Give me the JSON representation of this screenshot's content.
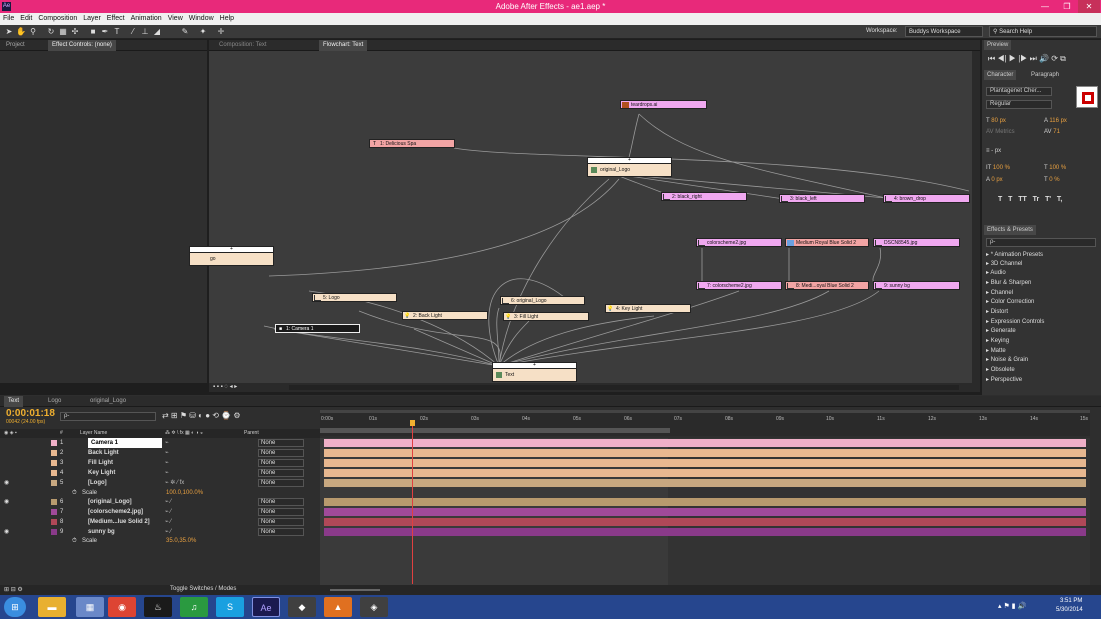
{
  "window": {
    "title": "Adobe After Effects - ae1.aep *",
    "app_icon": "Ae"
  },
  "menu": [
    "File",
    "Edit",
    "Composition",
    "Layer",
    "Effect",
    "Animation",
    "View",
    "Window",
    "Help"
  ],
  "workspace": {
    "label": "Workspace:",
    "value": "Buddys Workspace",
    "search_placeholder": "Search Help"
  },
  "left_panel": {
    "tabs": [
      "Project",
      "Effect Controls: (none)"
    ]
  },
  "flow_panel": {
    "tabs": [
      "Composition: Text",
      "Flowchart: Text"
    ]
  },
  "flowchart_nodes": {
    "teardrops": "teardrops.ai",
    "delicious_spa": "1: Delicious Spa",
    "original_logo_comp": "original_Logo",
    "black_right": "2: black_right",
    "black_left": "3: black_left",
    "brown_drop": "4: brown_drop",
    "logo_comp_partial": "go",
    "colorscheme2_src": "colorscheme2.jpg",
    "medium_royal_src": "Medium Royal Blue Solid 2",
    "dscn_src": "DSCN8545.jpg",
    "colorscheme2_layer": "7: colorscheme2.jpg",
    "medium_royal_layer": "8: Medi...oyal Blue Solid 2",
    "sunny_bg_layer": "9: sunny bg",
    "logo_layer": "5: Logo",
    "original_logo_layer": "6: original_Logo",
    "key_light": "4: Key Light",
    "back_light": "2: Back Light",
    "fill_light": "3: Fill Light",
    "camera1": "1: Camera 1",
    "text_comp": "Text"
  },
  "right_panel": {
    "preview_tab": "Preview",
    "character_tabs": [
      "Character",
      "Paragraph"
    ],
    "font": "Plantagenet Cher...",
    "style": "Regular",
    "size": "80 px",
    "leading": "116 px",
    "kerning": "Metrics",
    "tracking": "71",
    "stroke_px": "- px",
    "vscale": "100 %",
    "hscale": "100 %",
    "baseline": "0 px",
    "tsume": "0 %",
    "type_buttons": [
      "T",
      "T",
      "TT",
      "Tr",
      "T'",
      "T,"
    ],
    "effects_tab": "Effects & Presets",
    "effects_search": "ρ-",
    "effects": [
      "* Animation Presets",
      "3D Channel",
      "Audio",
      "Blur & Sharpen",
      "Channel",
      "Color Correction",
      "Distort",
      "Expression Controls",
      "Generate",
      "Keying",
      "Matte",
      "Noise & Grain",
      "Obsolete",
      "Perspective"
    ]
  },
  "timeline": {
    "tabs": [
      "Text",
      "Logo",
      "original_Logo"
    ],
    "timecode": "0:00:01:18",
    "fps": "00042 (24.00 fps)",
    "search": "ρ-",
    "col_num": "#",
    "col_name": "Layer Name",
    "col_parent": "Parent",
    "ruler": [
      "0:00s",
      "01s",
      "02s",
      "03s",
      "04s",
      "05s",
      "06s",
      "07s",
      "08s",
      "09s",
      "10s",
      "11s",
      "12s",
      "13s",
      "14s",
      "15s"
    ],
    "layers": [
      {
        "num": "1",
        "name": "Camera 1",
        "parent": "None",
        "color": "#f0b0c8"
      },
      {
        "num": "2",
        "name": "Back Light",
        "parent": "None",
        "color": "#e8b890"
      },
      {
        "num": "3",
        "name": "Fill Light",
        "parent": "None",
        "color": "#e8b890"
      },
      {
        "num": "4",
        "name": "Key Light",
        "parent": "None",
        "color": "#e8b890"
      },
      {
        "num": "5",
        "name": "[Logo]",
        "parent": "None",
        "color": "#c8a880"
      },
      {
        "num": "6",
        "name": "[original_Logo]",
        "parent": "None",
        "color": "#b89a6e"
      },
      {
        "num": "7",
        "name": "[colorscheme2.jpg]",
        "parent": "None",
        "color": "#a04a9a"
      },
      {
        "num": "8",
        "name": "[Medium...lue Solid 2]",
        "parent": "None",
        "color": "#b04858"
      },
      {
        "num": "9",
        "name": "sunny bg",
        "parent": "None",
        "color": "#8a3a8a"
      }
    ],
    "scale_label": "Scale",
    "scale5": "100.0,100.0%",
    "scale9": "35.0,35.0%",
    "toggle": "Toggle Switches / Modes"
  },
  "taskbar": {
    "time": "3:51 PM",
    "date": "5/30/2014",
    "ae_label": "Ae"
  }
}
